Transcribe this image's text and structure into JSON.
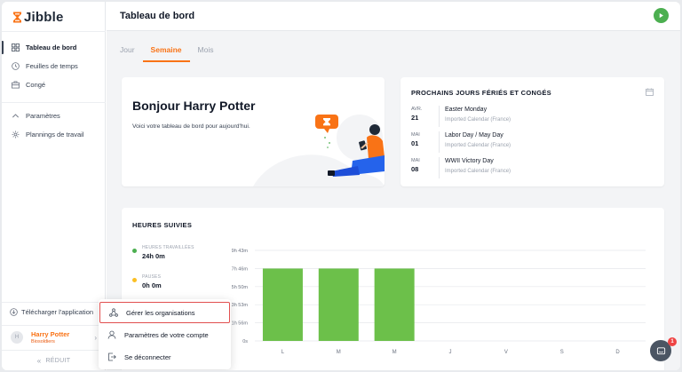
{
  "app": {
    "name": "Jibble",
    "brand_color": "#f97316",
    "accent_green": "#4caf50"
  },
  "sidebar": {
    "items": [
      {
        "label": "Tableau de bord",
        "icon": "dashboard-icon",
        "active": true
      },
      {
        "label": "Feuilles de temps",
        "icon": "clock-icon"
      },
      {
        "label": "Congé",
        "icon": "briefcase-icon"
      }
    ],
    "items2": [
      {
        "label": "Paramètres",
        "icon": "chevron-up-icon"
      },
      {
        "label": "Plannings de travail",
        "icon": "gear-icon"
      }
    ],
    "download_label": "Télécharger l'application",
    "user": {
      "initial": "H",
      "name": "Harry Potter",
      "role": "Biosoldiers"
    },
    "reduce_label": "RÉDUIT"
  },
  "header": {
    "title": "Tableau de bord"
  },
  "tabs": [
    {
      "label": "Jour"
    },
    {
      "label": "Semaine",
      "active": true
    },
    {
      "label": "Mois"
    }
  ],
  "welcome": {
    "greeting": "Bonjour Harry Potter",
    "subtitle": "Voici votre tableau de bord pour aujourd'hui."
  },
  "holidays": {
    "title": "PROCHAINS JOURS FÉRIÉS ET CONGÉS",
    "items": [
      {
        "month": "AVR.",
        "day": "21",
        "name": "Easter Monday",
        "source": "Imported Calendar (France)"
      },
      {
        "month": "MAI",
        "day": "01",
        "name": "Labor Day / May Day",
        "source": "Imported Calendar (France)"
      },
      {
        "month": "MAI",
        "day": "08",
        "name": "WWII Victory Day",
        "source": "Imported Calendar (France)"
      }
    ]
  },
  "tracked": {
    "title": "HEURES SUIVIES",
    "worked_label": "HEURES TRAVAILLÉES",
    "worked_value": "24h 0m",
    "breaks_label": "PAUSES",
    "breaks_value": "0h 0m"
  },
  "chart_data": {
    "type": "bar",
    "categories": [
      "L",
      "M",
      "M",
      "J",
      "V",
      "S",
      "D"
    ],
    "values": [
      466,
      466,
      466,
      0,
      0,
      0,
      0
    ],
    "unit": "minutes",
    "yticks": [
      "0s",
      "1h 56m",
      "3h 53m",
      "5h 50m",
      "7h 46m",
      "9h 43m"
    ],
    "ylim": [
      0,
      583
    ],
    "bar_color": "#6cc04a",
    "grid": true
  },
  "menu": {
    "items": [
      {
        "label": "Gérer les organisations",
        "icon": "organization-icon",
        "highlighted": true
      },
      {
        "label": "Paramètres de votre compte",
        "icon": "user-icon"
      },
      {
        "label": "Se déconnecter",
        "icon": "logout-icon"
      }
    ]
  },
  "chat": {
    "badge": "1"
  }
}
